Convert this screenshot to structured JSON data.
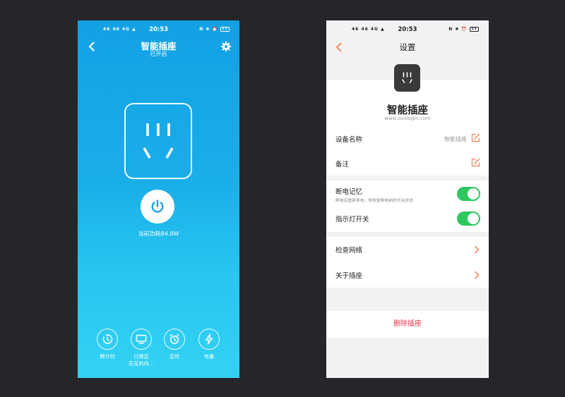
{
  "left_screen": {
    "status_bar": {
      "left_icons": "46 46 4G ▲",
      "time": "20:53",
      "right_icons": "N ✱ ⏰",
      "battery": "55"
    },
    "header": {
      "title": "智能插座",
      "subtitle": "已开启"
    },
    "power": {
      "consumption_label": "当前功耗84.8W"
    },
    "actions": [
      {
        "label": "倒计时",
        "icon": "countdown-icon"
      },
      {
        "label": "已绑定",
        "label2": "花花的向…",
        "icon": "tv-icon"
      },
      {
        "label": "定时",
        "icon": "alarm-clock-icon"
      },
      {
        "label": "电量",
        "icon": "lightning-icon"
      }
    ],
    "colors": {
      "gradient_top": "#13a1e4",
      "gradient_bottom": "#33d2f3",
      "power_icon": "#1aa3e6"
    }
  },
  "right_screen": {
    "status_bar": {
      "left_icons": "46 46 4G ▲",
      "time": "20:53",
      "right_icons": "N ✱ ⏰",
      "battery": "55"
    },
    "header": {
      "title": "设置"
    },
    "device": {
      "name": "智能插座",
      "website": "www.sunlogin.com"
    },
    "rows": {
      "device_name": {
        "label": "设备名称",
        "value": "智能插座"
      },
      "remark": {
        "label": "备注"
      },
      "power_memory": {
        "label": "断电记忆",
        "sub": "断电后重新来电，将恢复断电前的开关状态",
        "on": true
      },
      "indicator_light": {
        "label": "指示灯开关",
        "on": true
      },
      "check_network": {
        "label": "检查网络"
      },
      "about": {
        "label": "关于插座"
      }
    },
    "delete_label": "删除插座",
    "colors": {
      "accent": "#f0926a",
      "toggle_on": "#2fc760",
      "danger": "#e8344b"
    }
  }
}
